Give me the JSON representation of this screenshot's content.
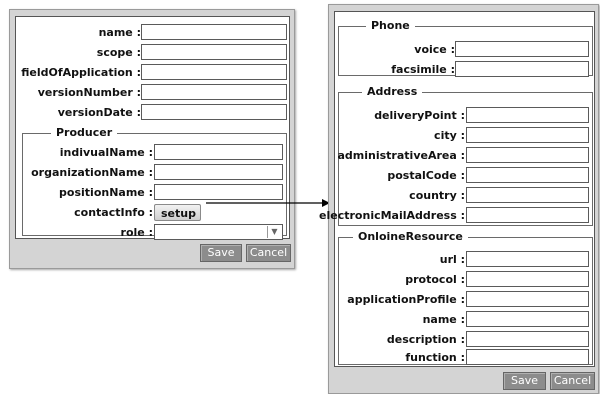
{
  "left_form": {
    "fields": {
      "name": {
        "label": "name :",
        "value": ""
      },
      "scope": {
        "label": "scope :",
        "value": ""
      },
      "field_of_application": {
        "label": "fieldOfApplication :",
        "value": ""
      },
      "version_number": {
        "label": "versionNumber :",
        "value": ""
      },
      "version_date": {
        "label": "versionDate :",
        "value": ""
      }
    },
    "producer": {
      "legend": "Producer",
      "indivual_name": {
        "label": "indivualName :",
        "value": ""
      },
      "organization_name": {
        "label": "organizationName :",
        "value": ""
      },
      "position_name": {
        "label": "positionName :",
        "value": ""
      },
      "contact_info": {
        "label": "contactInfo :",
        "button": "setup"
      },
      "role": {
        "label": "role :",
        "value": "",
        "arrow": "▼"
      }
    },
    "buttons": {
      "save": "Save",
      "cancel": "Cancel"
    }
  },
  "right_form": {
    "phone": {
      "legend": "Phone",
      "voice": {
        "label": "voice :",
        "value": ""
      },
      "facsimile": {
        "label": "facsimile :",
        "value": ""
      }
    },
    "address": {
      "legend": "Address",
      "delivery_point": {
        "label": "deliveryPoint :",
        "value": ""
      },
      "city": {
        "label": "city :",
        "value": ""
      },
      "administrative_area": {
        "label": "administrativeArea :",
        "value": ""
      },
      "postal_code": {
        "label": "postalCode :",
        "value": ""
      },
      "country": {
        "label": "country :",
        "value": ""
      },
      "electronic_mail_address": {
        "label": "electronicMailAddress :",
        "value": ""
      }
    },
    "online_resource": {
      "legend": "OnloineResource",
      "url": {
        "label": "url :",
        "value": ""
      },
      "protocol": {
        "label": "protocol :",
        "value": ""
      },
      "application_profile": {
        "label": "applicationProfile :",
        "value": ""
      },
      "name": {
        "label": "name :",
        "value": ""
      },
      "description": {
        "label": "description :",
        "value": ""
      },
      "function": {
        "label": "function :",
        "value": ""
      }
    },
    "buttons": {
      "save": "Save",
      "cancel": "Cancel"
    }
  }
}
